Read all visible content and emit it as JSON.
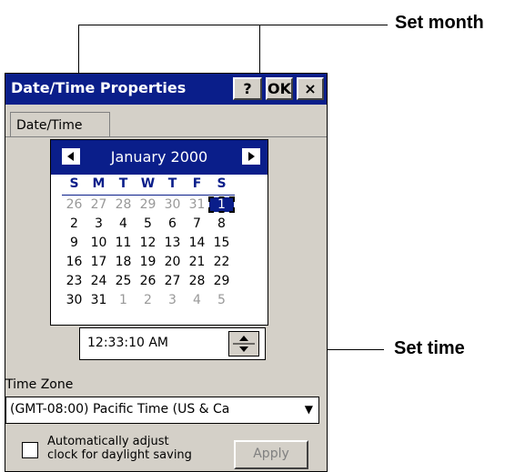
{
  "callouts": {
    "set_month": "Set month",
    "set_time": "Set time"
  },
  "window": {
    "title": "Date/Time Properties",
    "help_label": "?",
    "ok_label": "OK",
    "close_label": "×"
  },
  "tabs": [
    {
      "label": "Date/Time"
    }
  ],
  "calendar": {
    "month_year": "January 2000",
    "dow": [
      "S",
      "M",
      "T",
      "W",
      "T",
      "F",
      "S"
    ],
    "weeks": [
      [
        "26",
        "27",
        "28",
        "29",
        "30",
        "31",
        "1"
      ],
      [
        "2",
        "3",
        "4",
        "5",
        "6",
        "7",
        "8"
      ],
      [
        "9",
        "10",
        "11",
        "12",
        "13",
        "14",
        "15"
      ],
      [
        "16",
        "17",
        "18",
        "19",
        "20",
        "21",
        "22"
      ],
      [
        "23",
        "24",
        "25",
        "26",
        "27",
        "28",
        "29"
      ],
      [
        "30",
        "31",
        "1",
        "2",
        "3",
        "4",
        "5"
      ]
    ],
    "selected_day": "1"
  },
  "time": {
    "value": "12:33:10 AM"
  },
  "time_zone": {
    "label": "Time Zone",
    "selected": "(GMT-08:00) Pacific Time (US & Ca"
  },
  "daylight": {
    "label_line1": "Automatically adjust",
    "label_line2": "clock for daylight saving",
    "checked": false
  },
  "apply_label": "Apply",
  "icons": {
    "prev": "triangle-left-icon",
    "next": "triangle-right-icon",
    "spin": "spin-up-down-icon",
    "dropdown": "chevron-down-icon"
  },
  "colors": {
    "titlebar": "#0a1e8a",
    "window_bg": "#d4d0c8"
  }
}
